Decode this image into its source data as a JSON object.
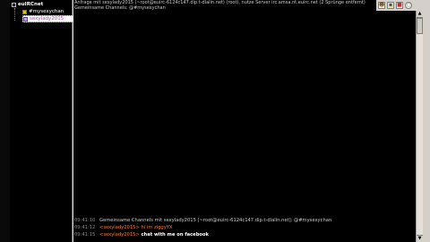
{
  "sidebar": {
    "root_label": "euIRCnet",
    "toggle_symbol": "-",
    "items": [
      {
        "label": "#mysexychan"
      },
      {
        "label": "sexylady2015"
      }
    ]
  },
  "topic_lines": [
    "Anfrage mit sexylady2015 (~root@euirc-6124c147.dip.t-dialin.net) (root), nutze Server irc.amsa.nt.euirc.net (2 Sprünge entfernt)",
    "Gemeinsame Channels: @#mysexychan"
  ],
  "messages": [
    {
      "time": "09:41:10",
      "text": "Gemeinsame Channels mit sexylady2015 [~root@euirc-6124c147.dip.t-dialin.net]: @#mysexychan"
    },
    {
      "time": "09:41:12",
      "nick": "<sexylady2015>",
      "text": "hi im ziggyYX"
    },
    {
      "time": "09:41:15",
      "nick": "<sexylady2015>",
      "text": "chat with me on facebook"
    }
  ],
  "toolbar": {
    "icons": [
      "person-icon",
      "image-icon",
      "stop-icon",
      "circle-icon"
    ]
  },
  "scrollbar": {
    "up_arrow": "▲",
    "down_arrow": "▼"
  },
  "colors": {
    "background": "#000000",
    "chrome": "#d4d0c8",
    "text": "#c8c8c8",
    "nick_highlight": "#ff7830",
    "selected_item_text": "#c040c0"
  }
}
